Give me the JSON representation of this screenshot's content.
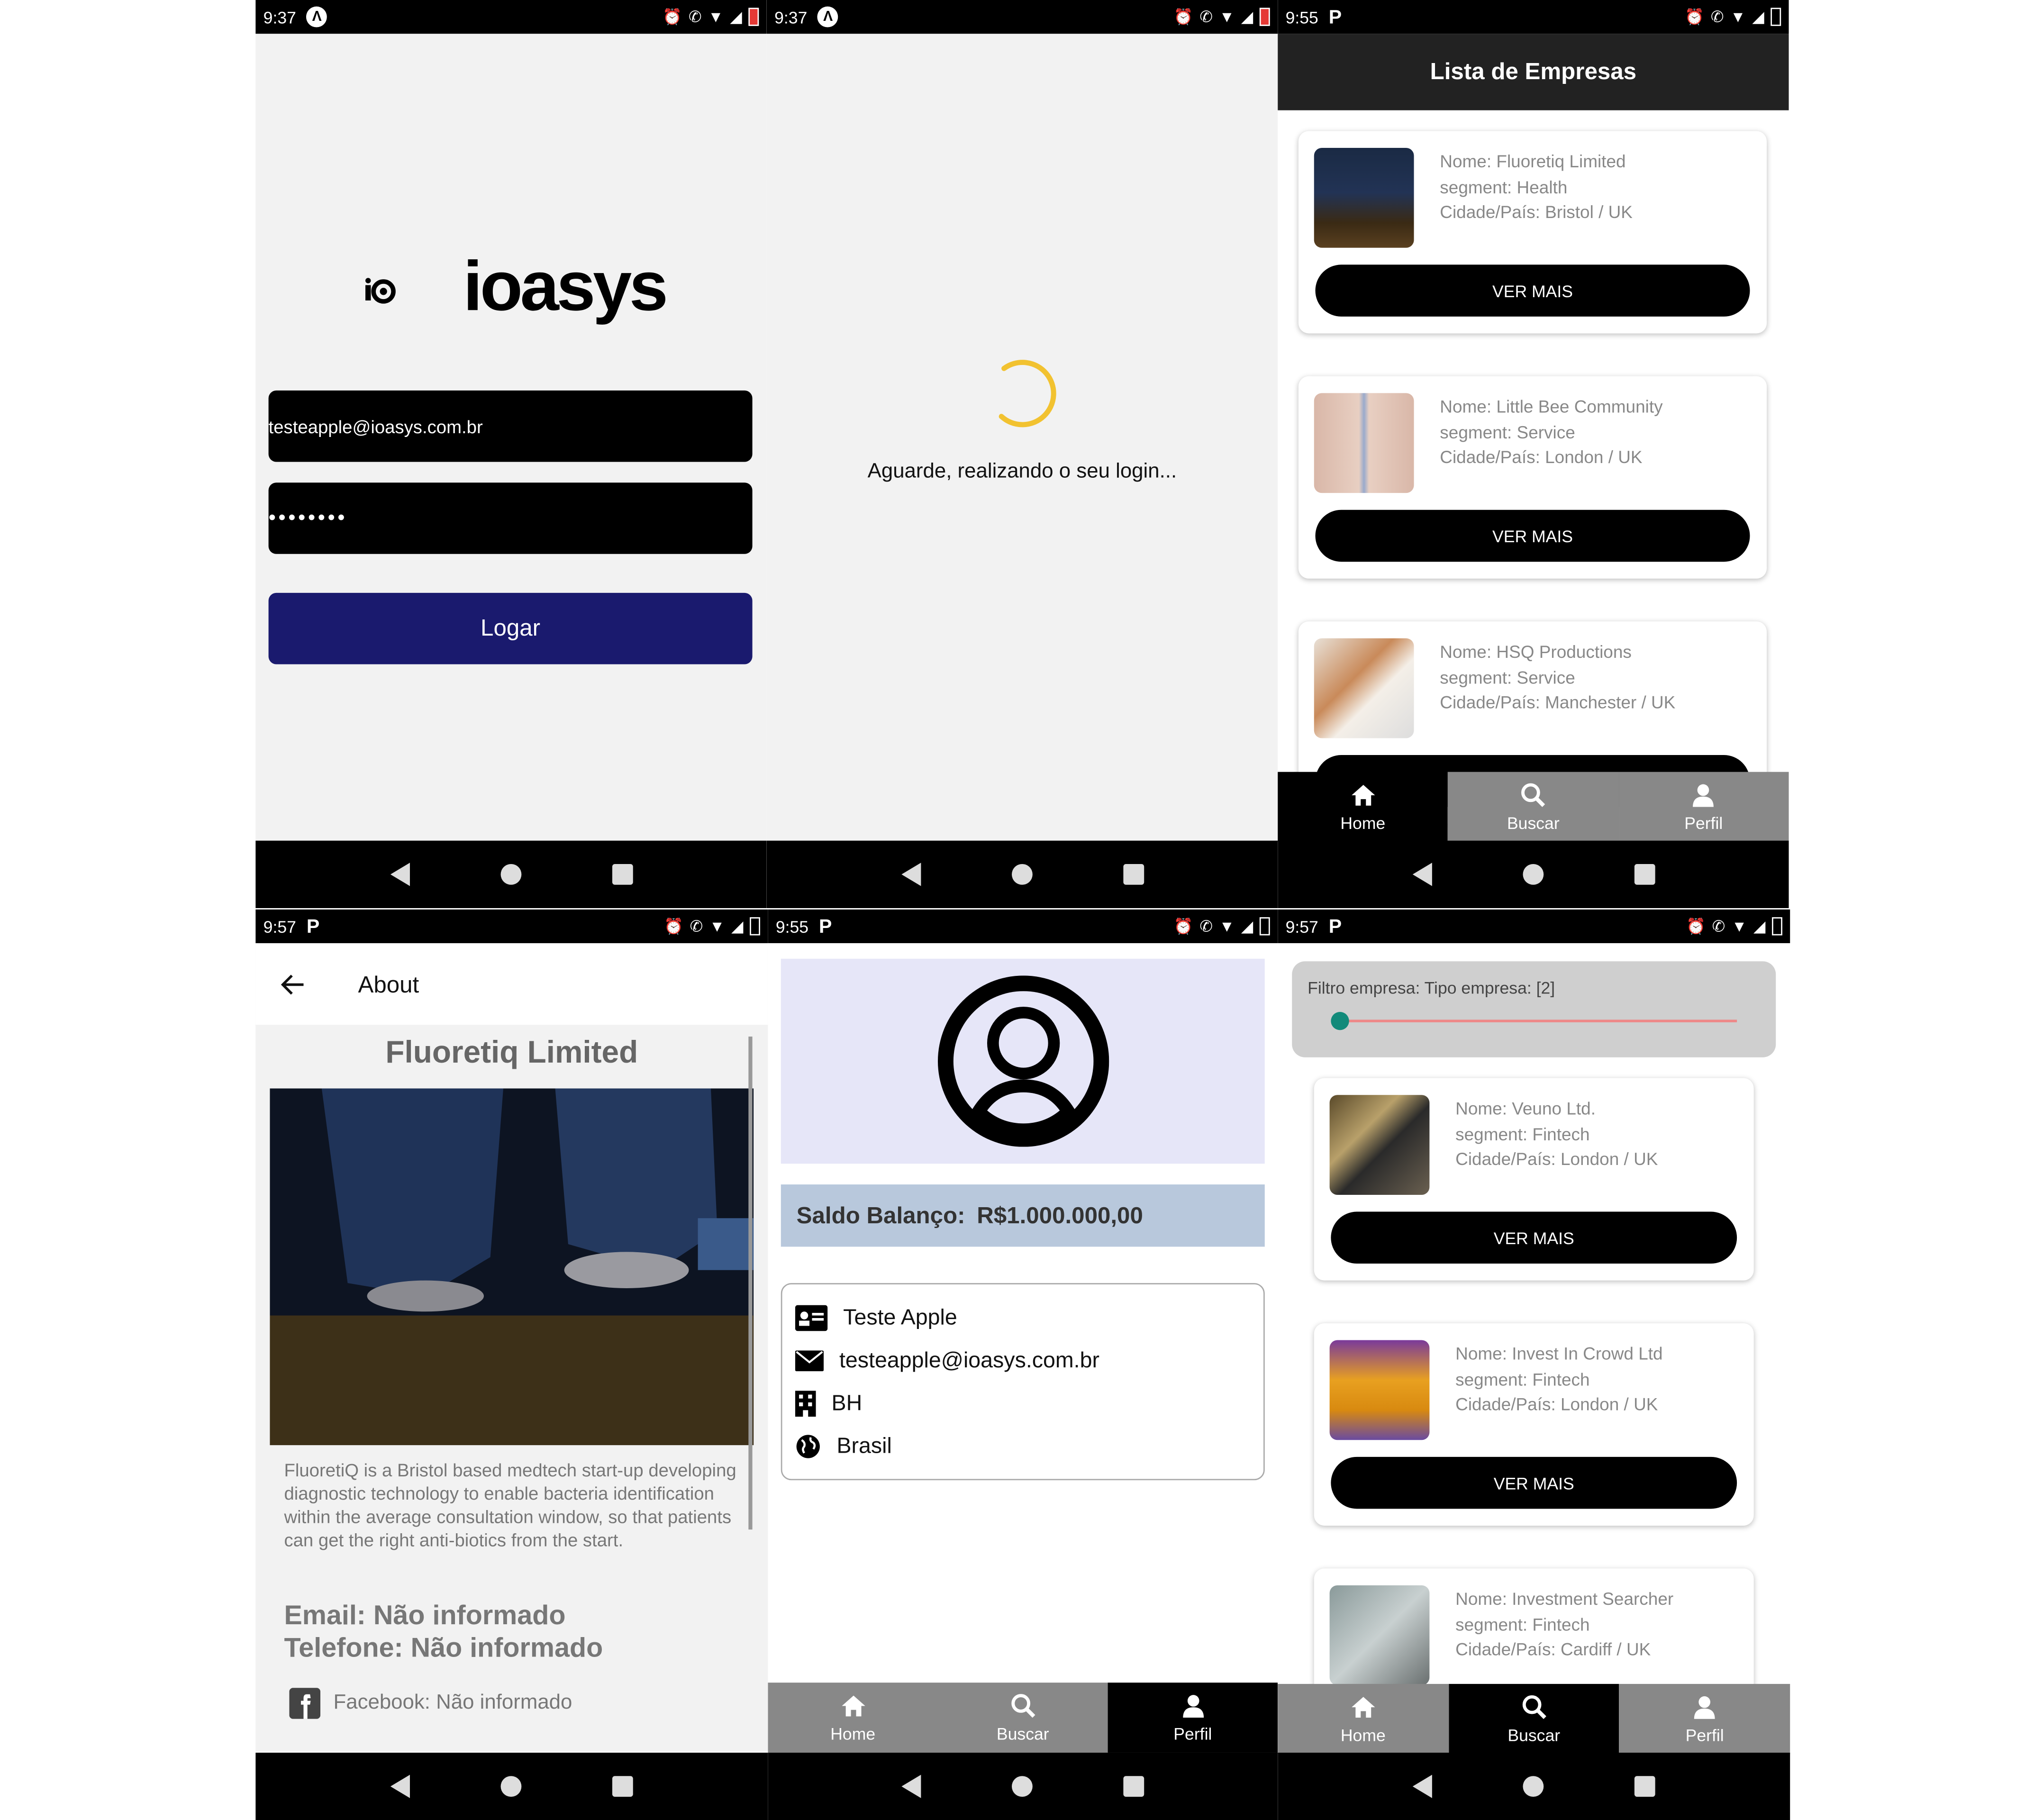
{
  "status": {
    "p1_time": "9:37",
    "p2_time": "9:37",
    "p3_time": "9:55",
    "p4_time": "9:57",
    "p5_time": "9:55",
    "p6_time": "9:57",
    "app_icon_a": "Λ",
    "app_icon_p": "P"
  },
  "login": {
    "logo_text": "ioasys",
    "email_value": "testeapple@ioasys.com.br",
    "password_value": "••••••••",
    "login_button": "Logar"
  },
  "loading": {
    "message": "Aguarde, realizando o seu login..."
  },
  "list": {
    "title": "Lista de Empresas",
    "button_label": "VER MAIS",
    "companies": [
      {
        "name": "Nome: Fluoretiq Limited",
        "segment": "segment: Health",
        "city": "Cidade/País: Bristol / UK"
      },
      {
        "name": "Nome: Little Bee Community",
        "segment": "segment: Service",
        "city": "Cidade/País: London / UK"
      },
      {
        "name": "Nome: HSQ Productions",
        "segment": "segment: Service",
        "city": "Cidade/País: Manchester / UK"
      }
    ]
  },
  "tabs": {
    "home": "Home",
    "search": "Buscar",
    "profile": "Perfil"
  },
  "about": {
    "bar_title": "About",
    "company": "Fluoretiq Limited",
    "description": "FluoretiQ is a Bristol based medtech start-up developing diagnostic technology to enable bacteria identification within the average consultation window, so that patients can get the right anti-biotics from the start.",
    "email": "Email: Não informado",
    "phone": "Telefone: Não informado",
    "facebook": "Facebook: Não informado"
  },
  "profile": {
    "saldo_label": "Saldo Balanço:",
    "saldo_value": "R$1.000.000,00",
    "name": "Teste Apple",
    "email": "testeapple@ioasys.com.br",
    "city": "BH",
    "country": "Brasil"
  },
  "search": {
    "filter_label": "Filtro empresa: Tipo empresa: [2]",
    "filter_value": 2,
    "button_label": "VER MAIS",
    "companies": [
      {
        "name": "Nome: Veuno Ltd.",
        "segment": "segment: Fintech",
        "city": "Cidade/País: London / UK"
      },
      {
        "name": "Nome: Invest In Crowd Ltd",
        "segment": "segment: Fintech",
        "city": "Cidade/País: London / UK"
      },
      {
        "name": "Nome: Investment Searcher",
        "segment": "segment: Fintech",
        "city": "Cidade/País: Cardiff / UK"
      }
    ]
  },
  "colors": {
    "login_button": "#1a1a6e",
    "spinner": "#f2c230",
    "slider_thumb": "#128a7a",
    "saldo_bg": "#b8c8dc",
    "avatar_bg": "#e6e6f8"
  }
}
